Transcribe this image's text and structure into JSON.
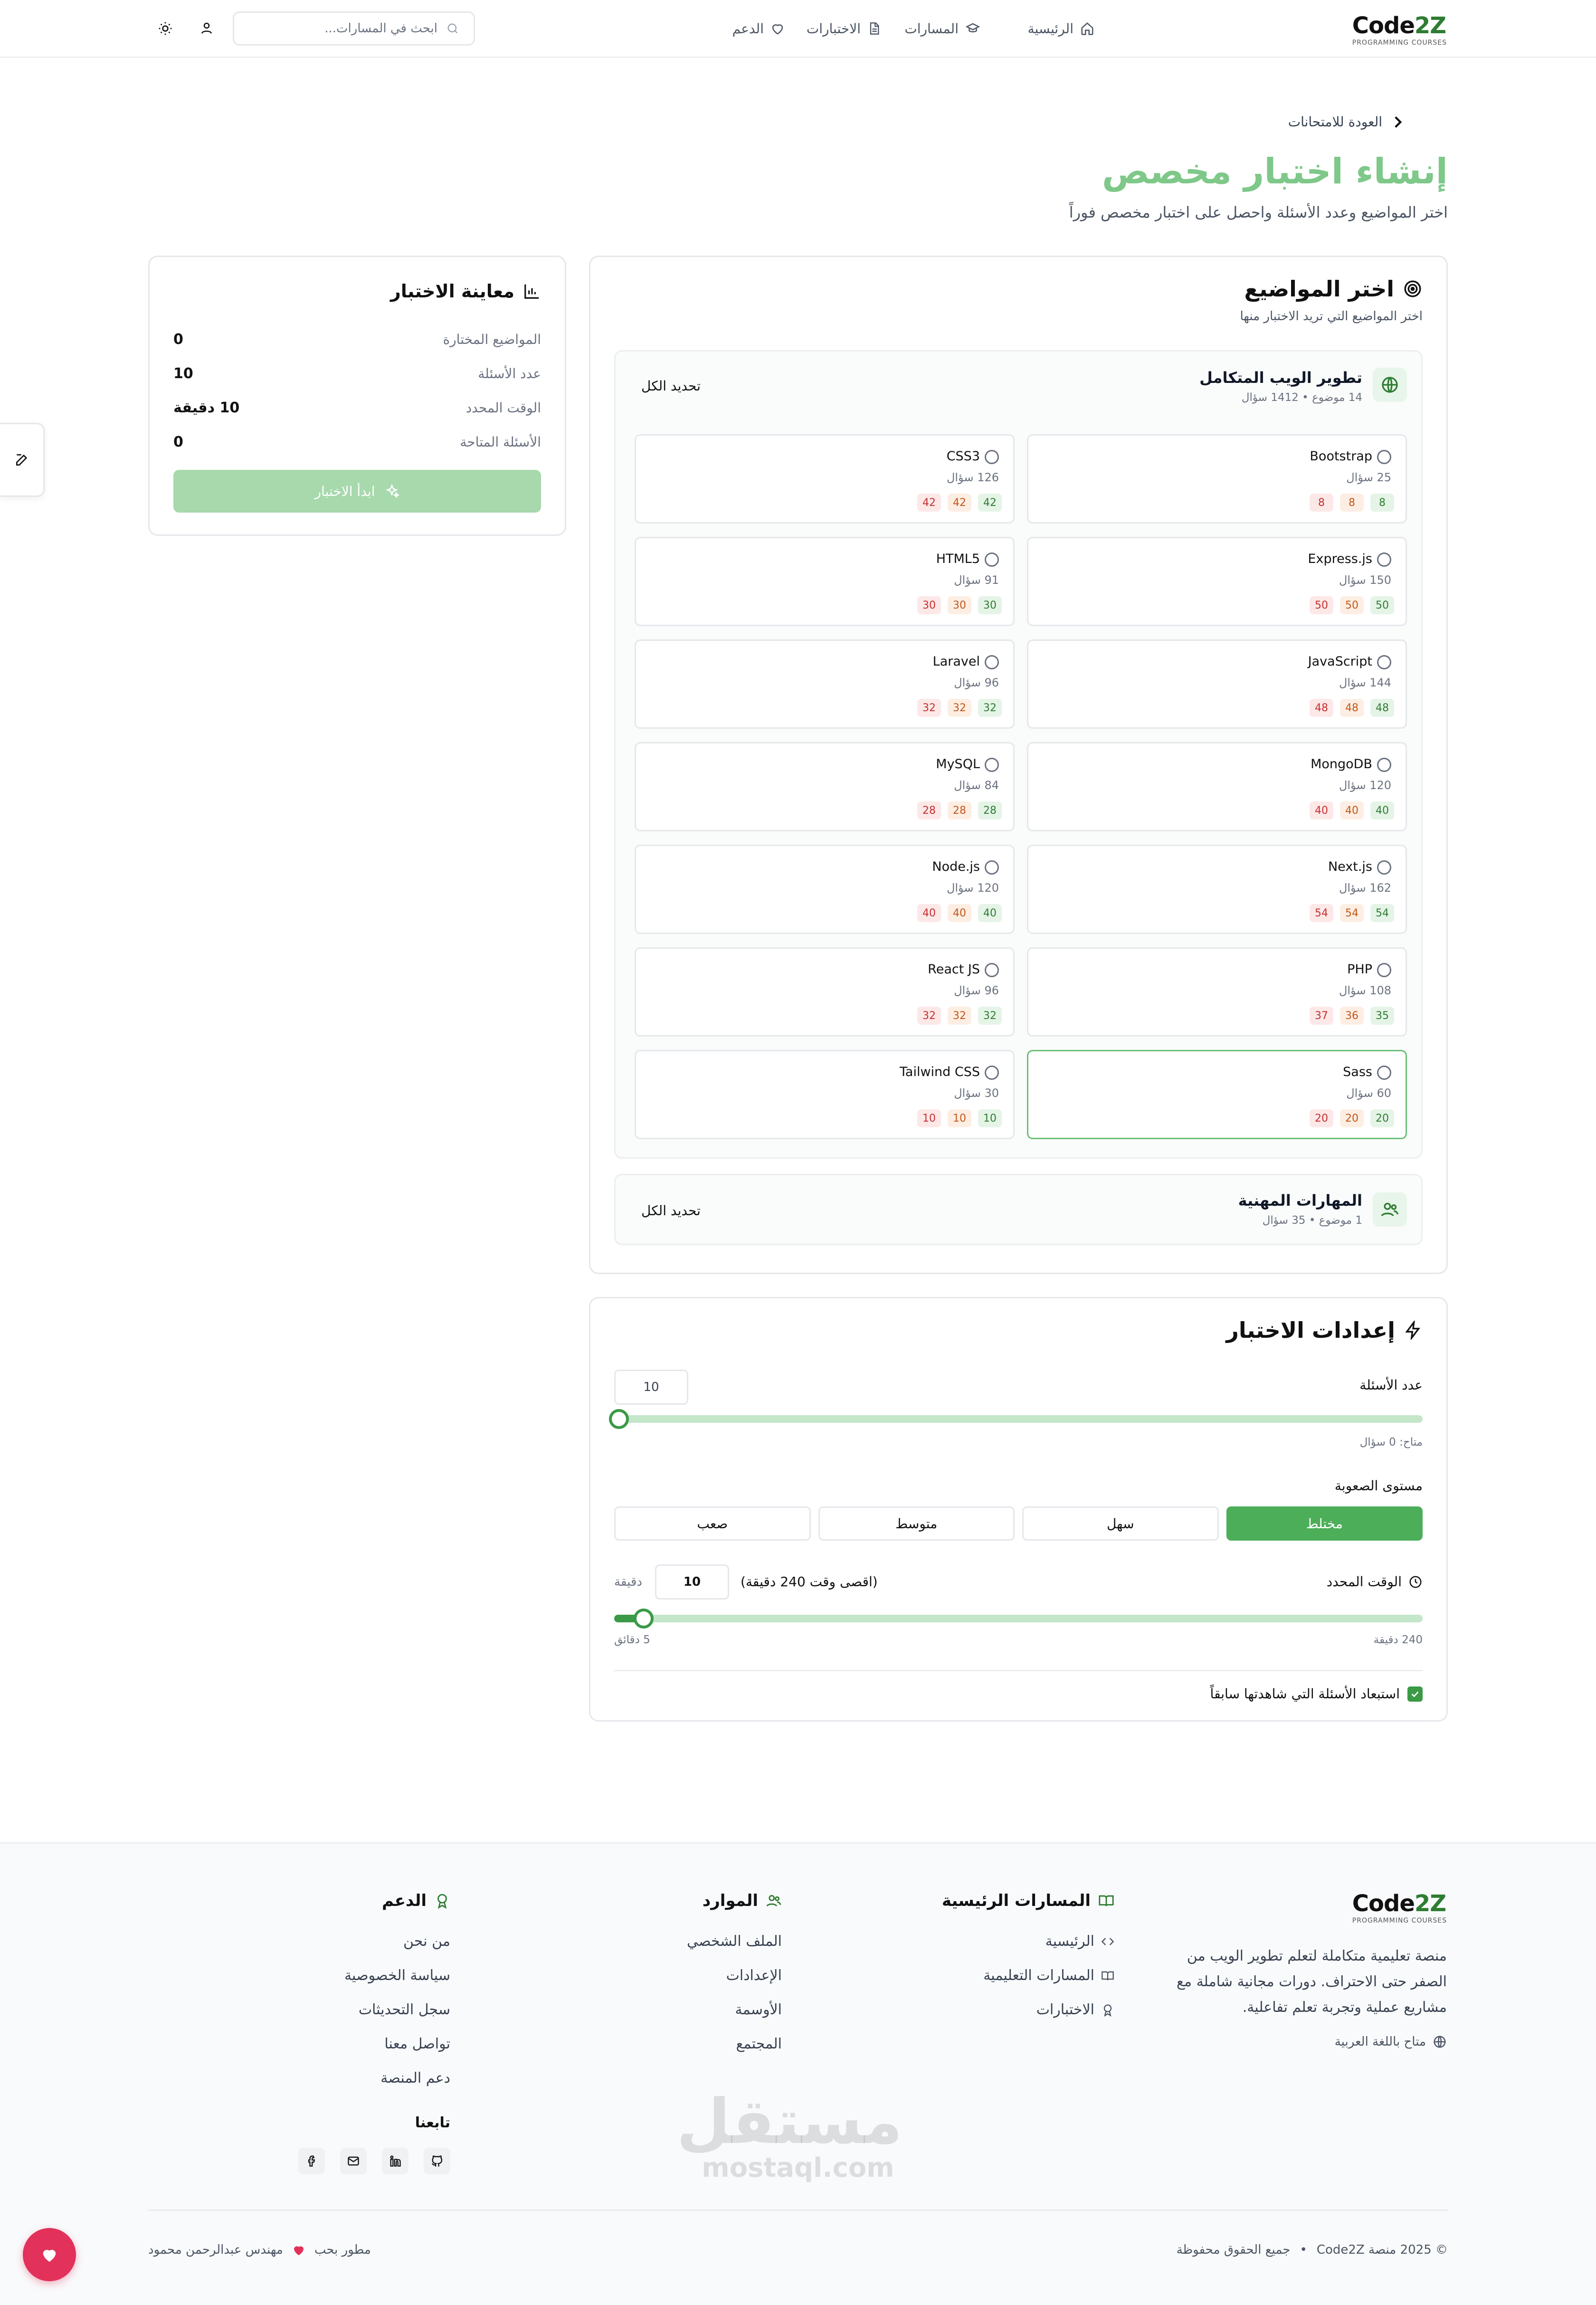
{
  "header": {
    "logo_main": "Code2Z",
    "logo_sub": "PROGRAMMING COURSES",
    "nav": {
      "home": "الرئيسية",
      "tracks": "المسارات",
      "exams": "الاختبارات",
      "support": "الدعم"
    },
    "search_placeholder": "ابحث في المسارات..."
  },
  "page": {
    "back": "العودة للامتحانات",
    "title": "إنشاء اختبار مخصص",
    "subtitle": "اختر المواضيع وعدد الأسئلة واحصل على اختبار مخصص فوراً"
  },
  "preview": {
    "title": "معاينة الاختبار",
    "selected_topics_label": "المواضيع المختارة",
    "selected_topics_value": "0",
    "questions_label": "عدد الأسئلة",
    "questions_value": "10",
    "time_label": "الوقت المحدد",
    "time_value": "10 دقيقة",
    "available_label": "الأسئلة المتاحة",
    "available_value": "0",
    "start_button": "ابدأ الاختبار"
  },
  "topics": {
    "title": "اختر المواضيع",
    "subtitle": "اختر المواضيع التي تريد الاختبار منها",
    "groups": [
      {
        "name": "تطوير الويب المتكامل",
        "meta": "14 موضوع • 1412 سؤال",
        "select_all": "تحديد الكل"
      },
      {
        "name": "المهارات المهنية",
        "meta": "1 موضوع • 35 سؤال",
        "select_all": "تحديد الكل"
      }
    ],
    "items": [
      {
        "name": "Bootstrap",
        "count": "25 سؤال",
        "badges": [
          "8",
          "8",
          "8"
        ]
      },
      {
        "name": "CSS3",
        "count": "126 سؤال",
        "badges": [
          "42",
          "42",
          "42"
        ]
      },
      {
        "name": "Express.js",
        "count": "150 سؤال",
        "badges": [
          "50",
          "50",
          "50"
        ]
      },
      {
        "name": "HTML5",
        "count": "91 سؤال",
        "badges": [
          "30",
          "30",
          "30"
        ]
      },
      {
        "name": "JavaScript",
        "count": "144 سؤال",
        "badges": [
          "48",
          "48",
          "48"
        ]
      },
      {
        "name": "Laravel",
        "count": "96 سؤال",
        "badges": [
          "32",
          "32",
          "32"
        ]
      },
      {
        "name": "MongoDB",
        "count": "120 سؤال",
        "badges": [
          "40",
          "40",
          "40"
        ]
      },
      {
        "name": "MySQL",
        "count": "84 سؤال",
        "badges": [
          "28",
          "28",
          "28"
        ]
      },
      {
        "name": "Next.js",
        "count": "162 سؤال",
        "badges": [
          "54",
          "54",
          "54"
        ]
      },
      {
        "name": "Node.js",
        "count": "120 سؤال",
        "badges": [
          "40",
          "40",
          "40"
        ]
      },
      {
        "name": "PHP",
        "count": "108 سؤال",
        "badges": [
          "35",
          "36",
          "37"
        ]
      },
      {
        "name": "React JS",
        "count": "96 سؤال",
        "badges": [
          "32",
          "32",
          "32"
        ]
      },
      {
        "name": "Sass",
        "count": "60 سؤال",
        "badges": [
          "20",
          "20",
          "20"
        ]
      },
      {
        "name": "Tailwind CSS",
        "count": "30 سؤال",
        "badges": [
          "10",
          "10",
          "10"
        ]
      }
    ]
  },
  "settings": {
    "title": "إعدادات الاختبار",
    "questions_label": "عدد الأسئلة",
    "questions_value": "10",
    "questions_slider_fraction": 0,
    "available_note": "متاح: 0 سؤال",
    "difficulty_label": "مستوى الصعوبة",
    "difficulty_options": [
      "مختلط",
      "سهل",
      "متوسط",
      "صعب"
    ],
    "difficulty_selected": "مختلط",
    "time_label": "الوقت المحدد",
    "time_max_note": "(اقصى وقت 240 دقيقة)",
    "time_value": "10",
    "time_unit": "دقيقة",
    "time_slider_fraction": 0.02,
    "time_min_label": "5 دقائق",
    "time_max_label": "240 دقيقة",
    "exclude_label": "استبعاد الأسئلة التي شاهدتها سابقاً",
    "exclude_checked": true
  },
  "footer": {
    "logo_main": "Code2Z",
    "logo_sub": "PROGRAMMING COURSES",
    "about": "منصة تعليمية متكاملة لتعلم تطوير الويب من الصفر حتى الاحتراف. دورات مجانية شاملة مع مشاريع عملية وتجربة تعلم تفاعلية.",
    "lang": "متاح باللغة العربية",
    "col_tracks": {
      "title": "المسارات الرئيسية",
      "links": [
        "الرئيسية",
        "المسارات التعليمية",
        "الاختبارات"
      ]
    },
    "col_resources": {
      "title": "الموارد",
      "links": [
        "الملف الشخصي",
        "الإعدادات",
        "الأوسمة",
        "المجتمع"
      ]
    },
    "col_support": {
      "title": "الدعم",
      "links": [
        "من نحن",
        "سياسة الخصوصية",
        "سجل التحديثات",
        "تواصل معنا",
        "دعم المنصة"
      ]
    },
    "follow": "تابعنا",
    "copyright": "© 2025 منصة Code2Z",
    "rights": "جميع الحقوق محفوظة",
    "made_by_prefix": "مطور بحب",
    "made_by_name": "مهندس عبدالرحمن محمود"
  },
  "watermark": {
    "arabic": "مستقل",
    "latin": "mostaql.com"
  },
  "colors": {
    "brand_green": "#4cae58",
    "title_green": "#7ec889",
    "heart_red": "#e2315a"
  }
}
